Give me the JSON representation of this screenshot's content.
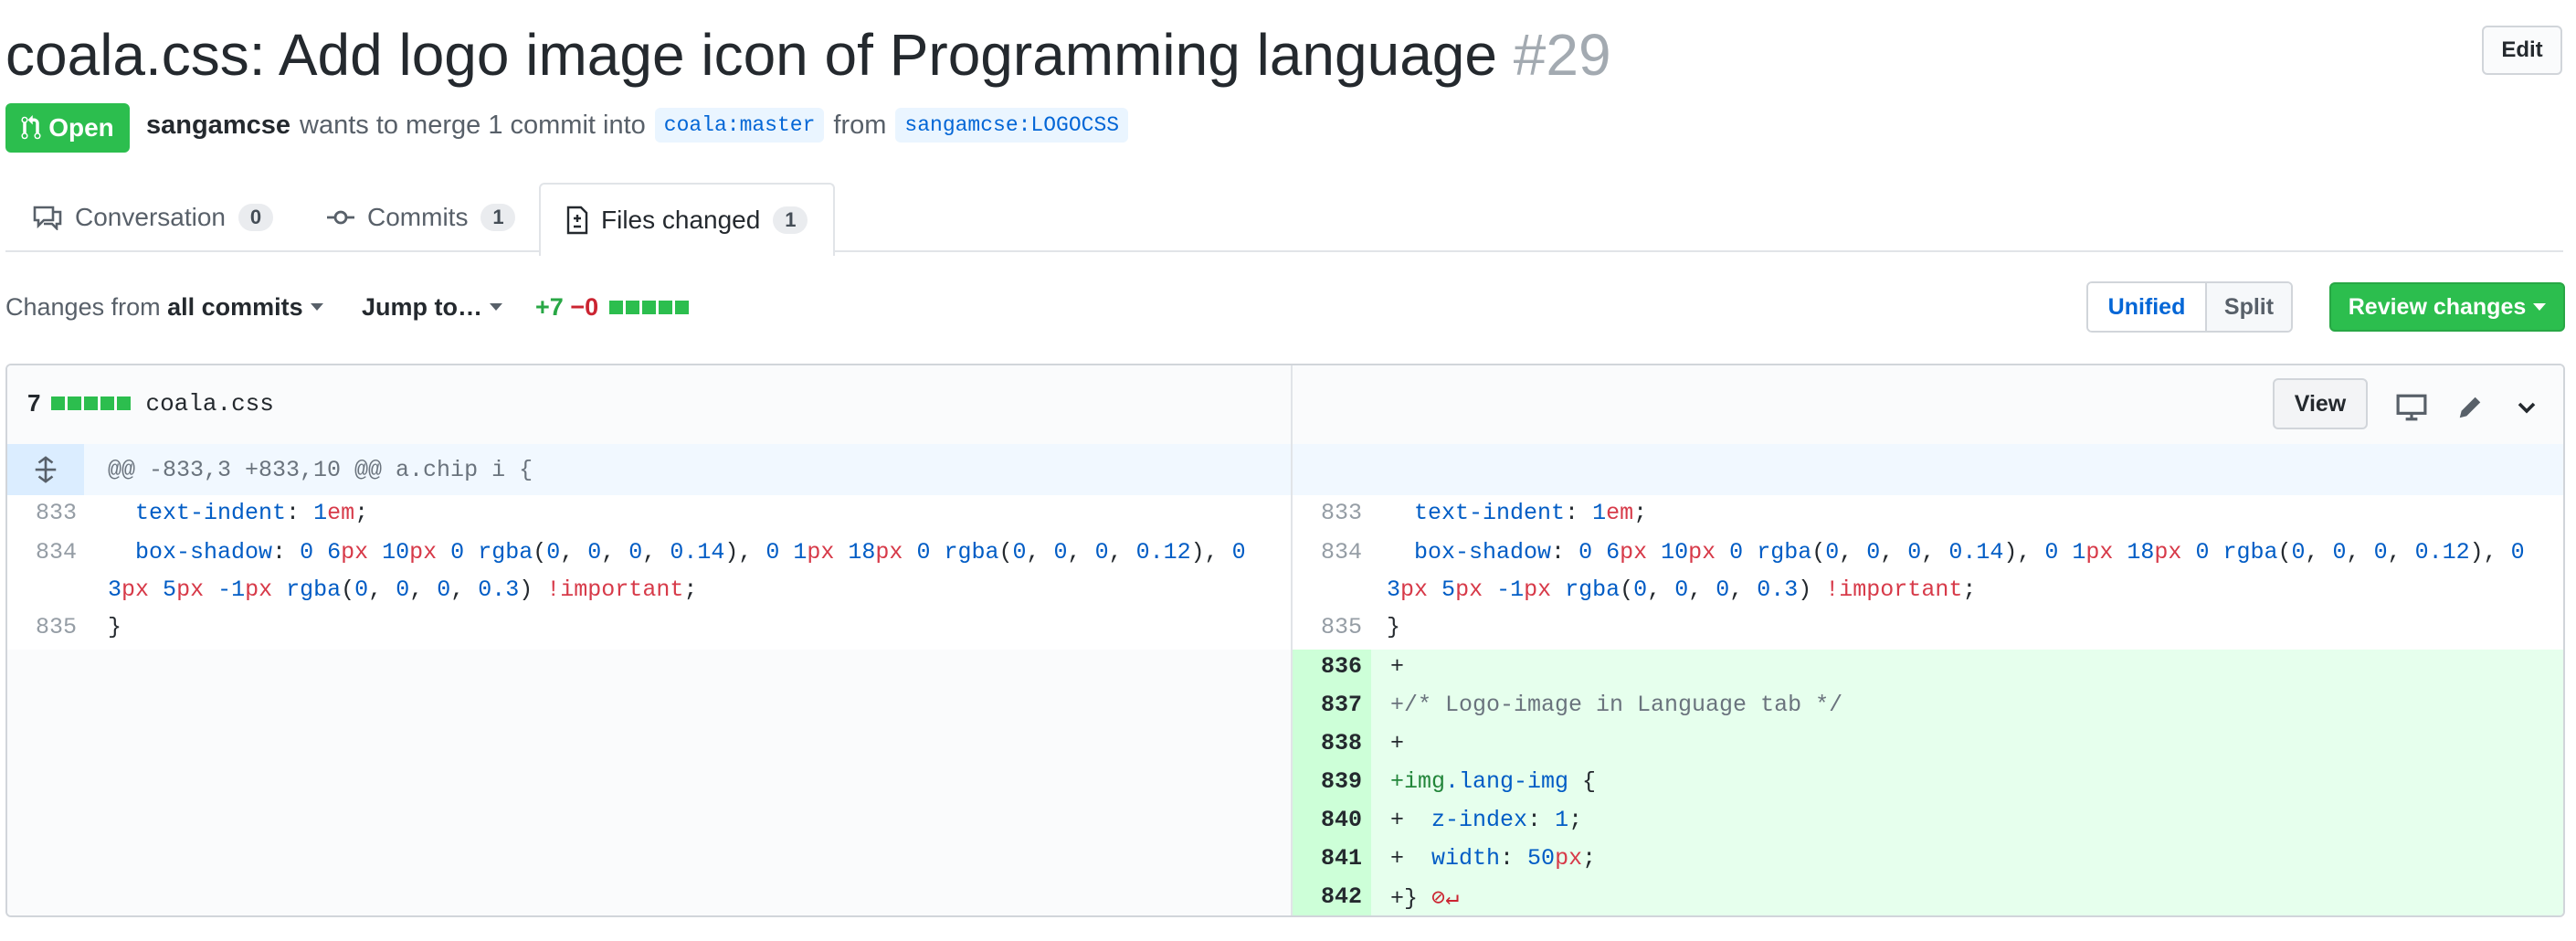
{
  "pr": {
    "title": "coala.css: Add logo image icon of Programming language",
    "number": "#29",
    "edit_label": "Edit",
    "state": "Open",
    "author": "sangamcse",
    "merge_text": "wants to merge 1 commit into",
    "base_ref": "coala:master",
    "from_text": "from",
    "head_ref": "sangamcse:LOGOCSS"
  },
  "tabs": [
    {
      "label": "Conversation",
      "count": "0",
      "icon": "comment-icon"
    },
    {
      "label": "Commits",
      "count": "1",
      "icon": "commit-icon"
    },
    {
      "label": "Files changed",
      "count": "1",
      "icon": "file-diff-icon",
      "active": true
    }
  ],
  "toolbar": {
    "changes_prefix": "Changes from",
    "changes_value": "all commits",
    "jump_label": "Jump to…",
    "additions": "+7",
    "deletions": "−0",
    "unified_label": "Unified",
    "split_label": "Split",
    "review_label": "Review changes"
  },
  "file": {
    "changes": "7",
    "name": "coala.css",
    "view_label": "View",
    "hunk_header": "@@ -833,3 +833,10 @@ a.chip i {",
    "left_lines": [
      {
        "num": "833"
      },
      {
        "num": "834"
      },
      {
        "num": "835"
      }
    ],
    "right_lines": [
      {
        "num": "833"
      },
      {
        "num": "834"
      },
      {
        "num": "835"
      },
      {
        "num": "836"
      },
      {
        "num": "837"
      },
      {
        "num": "838"
      },
      {
        "num": "839"
      },
      {
        "num": "840"
      },
      {
        "num": "841"
      },
      {
        "num": "842"
      }
    ],
    "code": {
      "indent_prop": "text-indent",
      "indent_val": "1em",
      "shadow_prop": "box-shadow",
      "close_brace": " }",
      "plus": "+",
      "comment": "+/* Logo-image in Language tab */",
      "selector_tag": "+img",
      "selector_class": ".lang-img",
      "open_brace": " {",
      "z_prop": "z-index",
      "z_val": "1",
      "w_prop": "width",
      "w_val": "50px",
      "last": "+}"
    }
  },
  "colors": {
    "accent_blue": "#0366d6",
    "open_green": "#2cbe4e",
    "addition_bg": "#e6ffed",
    "deletion_red": "#cb2431"
  }
}
